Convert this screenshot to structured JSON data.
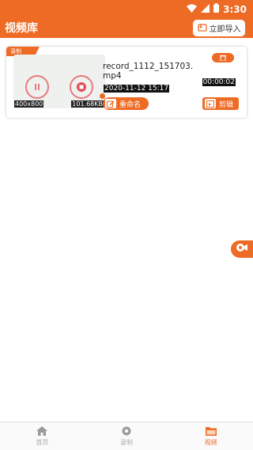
{
  "status_bar": {
    "time": "3:30"
  },
  "header": {
    "title": "视频库",
    "import_label": "立即导入"
  },
  "videos": [
    {
      "tag": "录制",
      "filename": "record_1112_151703.mp4",
      "resolution": "400x800",
      "size": "101.68KB",
      "duration": "00:00:02",
      "date": "2020-11-12 15:17",
      "rename_label": "重命名",
      "edit_label": "剪辑"
    }
  ],
  "bottom_nav": {
    "items": [
      {
        "label": "首页",
        "icon": "home-icon",
        "active": false
      },
      {
        "label": "录制",
        "icon": "record-icon",
        "active": false
      },
      {
        "label": "视频",
        "icon": "folder-icon",
        "active": true
      }
    ]
  },
  "colors": {
    "accent": "#ee6b25",
    "inactive": "#aaaaaa"
  }
}
